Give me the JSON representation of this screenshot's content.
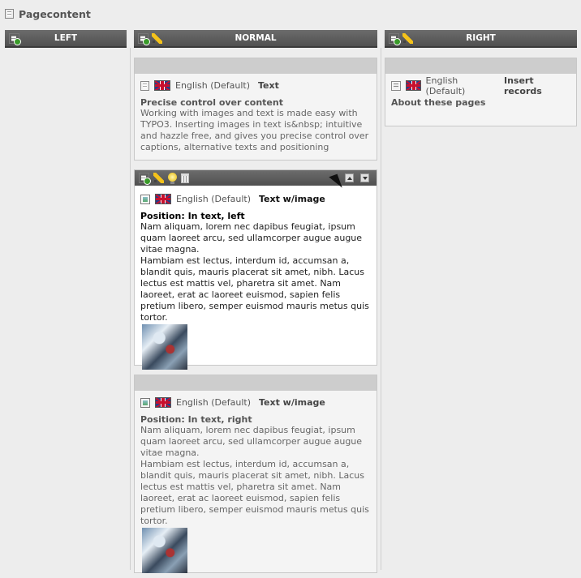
{
  "page": {
    "title": "Pagecontent",
    "title_icon": "page-icon"
  },
  "columns": [
    {
      "label": "LEFT"
    },
    {
      "label": "NORMAL"
    },
    {
      "label": "RIGHT"
    }
  ],
  "normal": {
    "elements": [
      {
        "language": "English (Default)",
        "type": "Text",
        "header": "Precise control over content",
        "text": "Working with images and text is made easy with TYPO3. Inserting images in text is&nbsp; intuitive and hazzle free, and gives you precise control over captions, alternative texts and positioning"
      },
      {
        "language": "English (Default)",
        "type": "Text w/image",
        "header": "Position: In text, left",
        "text": "Nam aliquam, lorem nec dapibus feugiat, ipsum quam laoreet arcu, sed ullamcorper augue augue vitae magna.",
        "text2": "Hambiam est lectus, interdum id, accumsan a, blandit quis, mauris placerat sit amet, nibh. Lacus lectus est mattis vel, pharetra sit amet. Nam laoreet, erat ac laoreet euismod, sapien felis pretium libero, semper euismod mauris metus quis tortor."
      },
      {
        "language": "English (Default)",
        "type": "Text w/image",
        "header": "Position: In text, right",
        "text": "Nam aliquam, lorem nec dapibus feugiat, ipsum quam laoreet arcu, sed ullamcorper augue augue vitae magna.",
        "text2": "Hambiam est lectus, interdum id, accumsan a, blandit quis, mauris placerat sit amet, nibh. Lacus lectus est mattis vel, pharetra sit amet. Nam laoreet, erat ac laoreet euismod, sapien felis pretium libero, semper euismod mauris metus quis tortor."
      }
    ]
  },
  "right": {
    "elements": [
      {
        "language": "English (Default)",
        "type": "Insert records",
        "header": "About these pages"
      }
    ]
  }
}
